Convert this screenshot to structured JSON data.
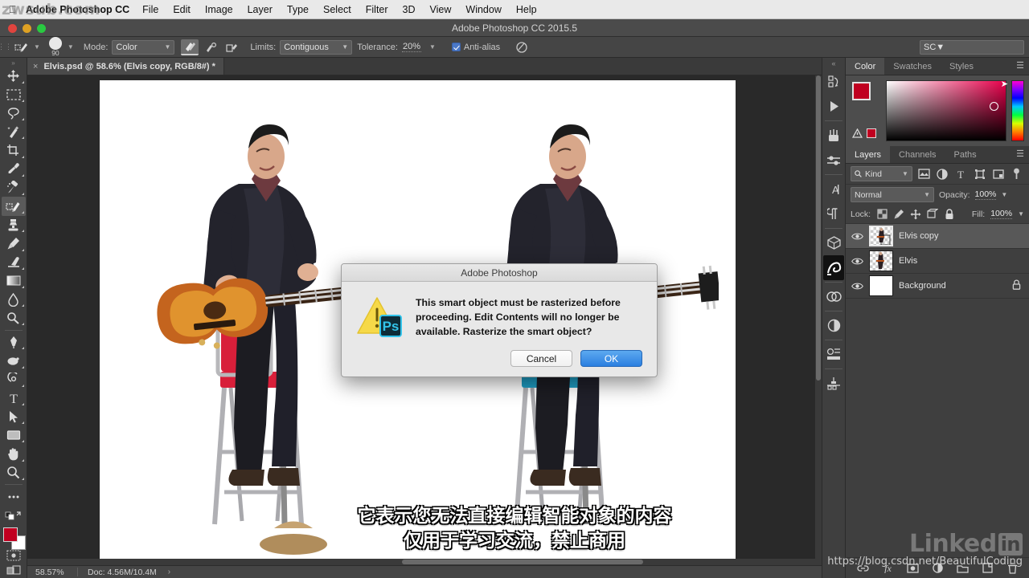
{
  "menubar": {
    "apple": "\u0001",
    "app_name": "Adobe Photoshop CC",
    "items": [
      "File",
      "Edit",
      "Image",
      "Layer",
      "Type",
      "Select",
      "Filter",
      "3D",
      "View",
      "Window",
      "Help"
    ],
    "watermark": "zwsub.com"
  },
  "titlebar": {
    "title": "Adobe Photoshop CC 2015.5"
  },
  "options_bar": {
    "brush_size": "90",
    "mode_label": "Mode:",
    "mode_value": "Color",
    "limits_label": "Limits:",
    "limits_value": "Contiguous",
    "tolerance_label": "Tolerance:",
    "tolerance_value": "20%",
    "antialias_label": "Anti-alias",
    "workspace_value": "SC"
  },
  "document_tab": {
    "title": "Elvis.psd @ 58.6% (Elvis copy, RGB/8#) *",
    "close": "×"
  },
  "toolbar": {
    "tools": [
      {
        "name": "move-tool"
      },
      {
        "name": "marquee-tool"
      },
      {
        "name": "lasso-tool"
      },
      {
        "name": "quick-selection-tool"
      },
      {
        "name": "crop-tool"
      },
      {
        "name": "eyedropper-tool"
      },
      {
        "name": "healing-brush-tool"
      },
      {
        "name": "color-replacement-tool",
        "active": true
      },
      {
        "name": "clone-stamp-tool"
      },
      {
        "name": "history-brush-tool"
      },
      {
        "name": "eraser-tool"
      },
      {
        "name": "gradient-tool"
      },
      {
        "name": "blur-tool"
      },
      {
        "name": "dodge-tool"
      },
      {
        "name": "pen-tool"
      },
      {
        "name": "type-tool"
      },
      {
        "name": "path-selection-tool"
      },
      {
        "name": "rectangle-tool"
      },
      {
        "name": "hand-tool"
      },
      {
        "name": "zoom-tool"
      },
      {
        "name": "more-tools"
      }
    ]
  },
  "status_bar": {
    "zoom": "58.57%",
    "doc": "Doc: 4.56M/10.4M",
    "arrow": "›"
  },
  "color_panel": {
    "tabs": [
      {
        "label": "Color",
        "active": true
      },
      {
        "label": "Swatches",
        "active": false
      },
      {
        "label": "Styles",
        "active": false
      }
    ],
    "foreground_color": "#c00020",
    "background_color": "#ffffff"
  },
  "layers_panel": {
    "tabs": [
      {
        "label": "Layers",
        "active": true
      },
      {
        "label": "Channels",
        "active": false
      },
      {
        "label": "Paths",
        "active": false
      }
    ],
    "kind_filter": "Kind",
    "blend_mode": "Normal",
    "opacity_label": "Opacity:",
    "opacity_value": "100%",
    "lock_label": "Lock:",
    "fill_label": "Fill:",
    "fill_value": "100%",
    "layers": [
      {
        "name": "Elvis copy",
        "selected": true,
        "locked": false,
        "visible": true
      },
      {
        "name": "Elvis",
        "selected": false,
        "locked": false,
        "visible": true
      },
      {
        "name": "Background",
        "selected": false,
        "locked": true,
        "visible": true
      }
    ]
  },
  "dialog": {
    "title": "Adobe Photoshop",
    "icon_name": "warning-photoshop-icon",
    "message": "This smart object must be rasterized before proceeding.  Edit Contents will no longer be available.  Rasterize the smart object?",
    "cancel_label": "Cancel",
    "ok_label": "OK",
    "ok_color": "#2b7fe0"
  },
  "subtitles": {
    "line1": "它表示您无法直接编辑智能对象的内容",
    "line2": "仅用于学习交流，禁止商用"
  },
  "watermarks": {
    "linkedin_text": "Linked",
    "linkedin_badge": "in",
    "url": "https://blog.csdn.net/BeautifulCoding"
  }
}
